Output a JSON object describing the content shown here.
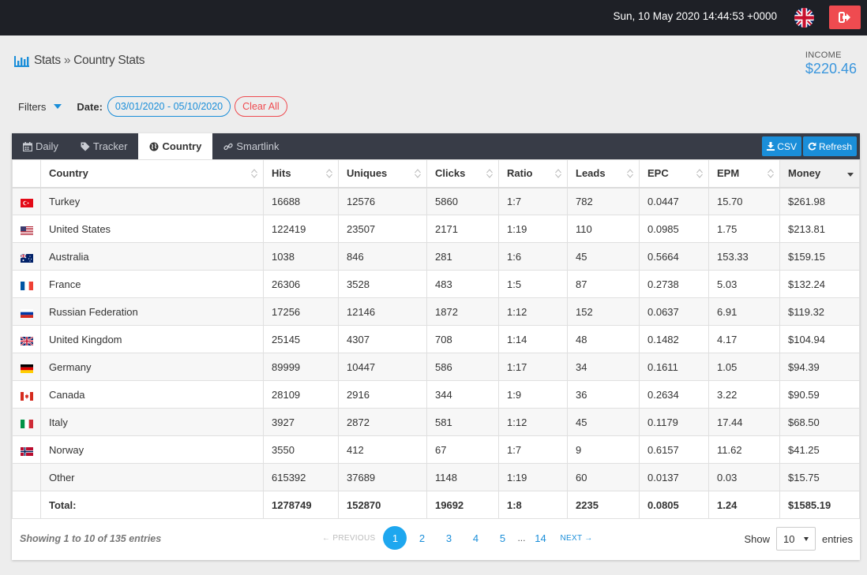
{
  "topbar": {
    "datetime": "Sun, 10 May 2020 14:44:53 +0000",
    "language_flag": "uk-flag-icon",
    "logout_icon": "logout-icon"
  },
  "breadcrumb": {
    "root": "Stats",
    "separator": "»",
    "current": "Country Stats"
  },
  "income": {
    "label": "INCOME",
    "value": "$220.46"
  },
  "filters": {
    "label": "Filters",
    "date_label": "Date:",
    "date_range": "03/01/2020 - 05/10/2020",
    "clear_label": "Clear All"
  },
  "tabs": [
    {
      "label": "Daily",
      "icon": "calendar-icon"
    },
    {
      "label": "Tracker",
      "icon": "tag-icon"
    },
    {
      "label": "Country",
      "icon": "globe-icon",
      "active": true
    },
    {
      "label": "Smartlink",
      "icon": "link-icon"
    }
  ],
  "tools": {
    "csv_label": "CSV",
    "refresh_label": "Refresh"
  },
  "table": {
    "columns": [
      "Country",
      "Hits",
      "Uniques",
      "Clicks",
      "Ratio",
      "Leads",
      "EPC",
      "EPM",
      "Money"
    ],
    "sorted_column": "Money",
    "rows": [
      {
        "flag": "tr",
        "country": "Turkey",
        "hits": "16688",
        "uniques": "12576",
        "clicks": "5860",
        "ratio": "1:7",
        "leads": "782",
        "epc": "0.0447",
        "epm": "15.70",
        "money": "$261.98"
      },
      {
        "flag": "us",
        "country": "United States",
        "hits": "122419",
        "uniques": "23507",
        "clicks": "2171",
        "ratio": "1:19",
        "leads": "110",
        "epc": "0.0985",
        "epm": "1.75",
        "money": "$213.81"
      },
      {
        "flag": "au",
        "country": "Australia",
        "hits": "1038",
        "uniques": "846",
        "clicks": "281",
        "ratio": "1:6",
        "leads": "45",
        "epc": "0.5664",
        "epm": "153.33",
        "money": "$159.15"
      },
      {
        "flag": "fr",
        "country": "France",
        "hits": "26306",
        "uniques": "3528",
        "clicks": "483",
        "ratio": "1:5",
        "leads": "87",
        "epc": "0.2738",
        "epm": "5.03",
        "money": "$132.24"
      },
      {
        "flag": "ru",
        "country": "Russian Federation",
        "hits": "17256",
        "uniques": "12146",
        "clicks": "1872",
        "ratio": "1:12",
        "leads": "152",
        "epc": "0.0637",
        "epm": "6.91",
        "money": "$119.32"
      },
      {
        "flag": "gb",
        "country": "United Kingdom",
        "hits": "25145",
        "uniques": "4307",
        "clicks": "708",
        "ratio": "1:14",
        "leads": "48",
        "epc": "0.1482",
        "epm": "4.17",
        "money": "$104.94"
      },
      {
        "flag": "de",
        "country": "Germany",
        "hits": "89999",
        "uniques": "10447",
        "clicks": "586",
        "ratio": "1:17",
        "leads": "34",
        "epc": "0.1611",
        "epm": "1.05",
        "money": "$94.39"
      },
      {
        "flag": "ca",
        "country": "Canada",
        "hits": "28109",
        "uniques": "2916",
        "clicks": "344",
        "ratio": "1:9",
        "leads": "36",
        "epc": "0.2634",
        "epm": "3.22",
        "money": "$90.59"
      },
      {
        "flag": "it",
        "country": "Italy",
        "hits": "3927",
        "uniques": "2872",
        "clicks": "581",
        "ratio": "1:12",
        "leads": "45",
        "epc": "0.1179",
        "epm": "17.44",
        "money": "$68.50"
      },
      {
        "flag": "no",
        "country": "Norway",
        "hits": "3550",
        "uniques": "412",
        "clicks": "67",
        "ratio": "1:7",
        "leads": "9",
        "epc": "0.6157",
        "epm": "11.62",
        "money": "$41.25"
      },
      {
        "flag": "",
        "country": "Other",
        "hits": "615392",
        "uniques": "37689",
        "clicks": "1148",
        "ratio": "1:19",
        "leads": "60",
        "epc": "0.0137",
        "epm": "0.03",
        "money": "$15.75"
      }
    ],
    "total": {
      "label": "Total:",
      "hits": "1278749",
      "uniques": "152870",
      "clicks": "19692",
      "ratio": "1:8",
      "leads": "2235",
      "epc": "0.0805",
      "epm": "1.24",
      "money": "$1585.19"
    }
  },
  "footer": {
    "info": "Showing 1 to 10 of 135 entries",
    "prev_label": "← PREVIOUS",
    "next_label": "NEXT →",
    "pages": [
      "1",
      "2",
      "3",
      "4",
      "5"
    ],
    "ellipsis": "...",
    "last_page": "14",
    "current_page": "1",
    "show_label": "Show",
    "page_size": "10",
    "entries_label": "entries"
  },
  "colors": {
    "accent": "#1a8ed9",
    "danger": "#ef4b50",
    "topbar": "#1e2026",
    "tabbar": "#383c47"
  }
}
